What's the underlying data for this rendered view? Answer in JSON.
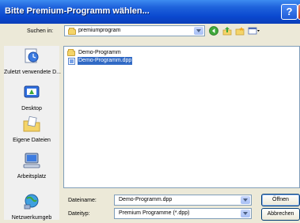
{
  "window": {
    "title": "Bitte Premium-Programm wählen...",
    "help_symbol": "?",
    "close_symbol": "X"
  },
  "lookin": {
    "label": "Suchen in:",
    "value": "premiumprogram"
  },
  "toolbar": {
    "icons": [
      "back-icon",
      "up-folder-icon",
      "new-folder-icon",
      "views-menu-icon"
    ]
  },
  "places": [
    {
      "label": "Zuletzt verwendete D...",
      "icon": "recent-documents-icon"
    },
    {
      "label": "Desktop",
      "icon": "desktop-icon"
    },
    {
      "label": "Eigene Dateien",
      "icon": "my-documents-icon"
    },
    {
      "label": "Arbeitsplatz",
      "icon": "my-computer-icon"
    },
    {
      "label": "Netzwerkumgeb",
      "icon": "network-places-icon"
    }
  ],
  "files": [
    {
      "name": "Demo-Programm",
      "type": "folder",
      "selected": false
    },
    {
      "name": "Demo-Programm.dpp",
      "type": "file",
      "selected": true
    }
  ],
  "filename": {
    "label": "Dateiname:",
    "value": "Demo-Programm.dpp"
  },
  "filetype": {
    "label": "Dateityp:",
    "value": "Premium Programme (*.dpp)"
  },
  "buttons": {
    "open": "Öffnen",
    "cancel": "Abbrechen"
  },
  "colors": {
    "titlebar": "#0a48cf",
    "selection": "#316ac5",
    "dialog_bg": "#ece9d8"
  }
}
